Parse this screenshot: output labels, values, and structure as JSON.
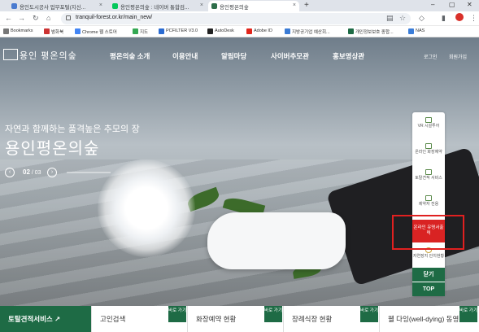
{
  "browser": {
    "tabs": [
      {
        "label": "용인도시공사 업무포털(지신...",
        "active": false,
        "fav": "#4a7bd0"
      },
      {
        "label": "용인평온의숲 : 네이버 통합검...",
        "active": false,
        "fav": "#03c75a"
      },
      {
        "label": "용인평온의숲",
        "active": true,
        "fav": "#2e6e4a"
      }
    ],
    "new_tab": "+",
    "url": "tranquil-forest.or.kr/main_new/",
    "bookmarks": [
      {
        "label": "Bookmarks",
        "color": "#777"
      },
      {
        "label": "밤화북",
        "color": "#c33"
      },
      {
        "label": "Chrome 웹 스토어",
        "color": "#4285f4"
      },
      {
        "label": "지도",
        "color": "#34a853"
      },
      {
        "label": "PCFILTER V3.0",
        "color": "#2a6bd1"
      },
      {
        "label": "AutoDesk",
        "color": "#222"
      },
      {
        "label": "Adobe ID",
        "color": "#e1251b"
      },
      {
        "label": "지방공기업 예산회...",
        "color": "#3a7bd5"
      },
      {
        "label": "개인정보보호 종합...",
        "color": "#1e6b45"
      },
      {
        "label": "NAS",
        "color": "#3b7dd8"
      }
    ]
  },
  "site": {
    "logo_text": "용인 평온의숲",
    "nav": [
      "평온의숲 소개",
      "이용안내",
      "알림마당",
      "사이버추모관",
      "홍보영상관"
    ],
    "util": [
      "로그인",
      "회원가입"
    ],
    "slogan_sub": "자연과 함께하는 품격높은 추모의 장",
    "slogan": "용인평온의숲",
    "slider": {
      "current": "02",
      "total": "03",
      "prev": "‹",
      "next": "›"
    }
  },
  "quick_menu": {
    "items": [
      "VR 시설투어",
      "온라인 화장예약",
      "토탈견적 서비스",
      "제약자 전용"
    ],
    "red_item": "온라인 유명서출력",
    "after_red": "자연장지 안치현황",
    "close": "닫기",
    "top": "TOP"
  },
  "bottom": {
    "sections": [
      {
        "title": "토탈견적서비스 ↗",
        "go": ""
      },
      {
        "title": "고인검색",
        "go": "바로 가기"
      },
      {
        "title": "화장예약 현황",
        "go": "바로 가기"
      },
      {
        "title": "장례식장 현황",
        "go": "바로 가기"
      },
      {
        "title": "웰 다잉(well-dying) 동영",
        "go": "바로 가기"
      }
    ]
  }
}
